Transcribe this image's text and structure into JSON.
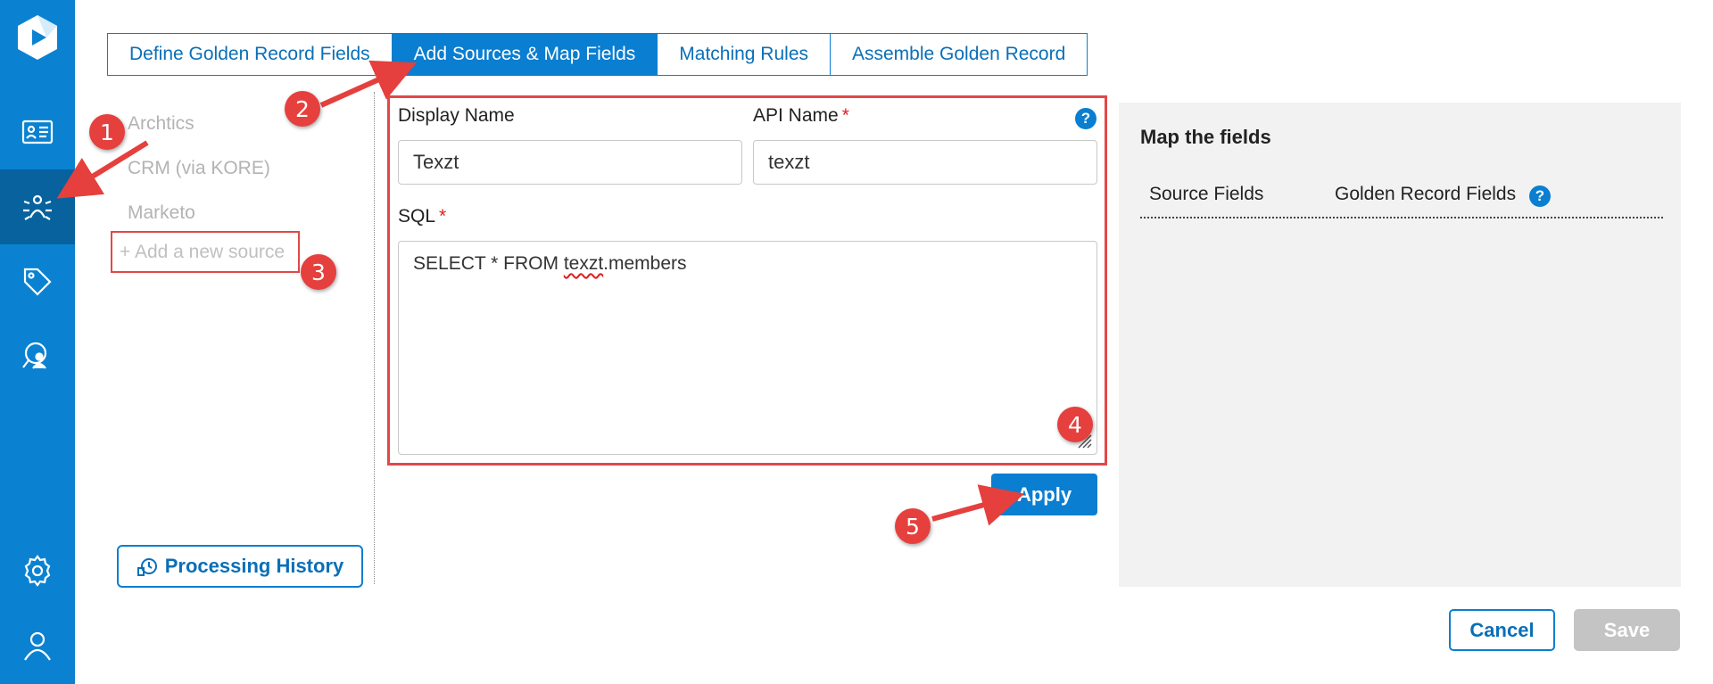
{
  "sidebar": {
    "icons": [
      "logo-icon",
      "contact-card-icon",
      "bug-network-icon",
      "tag-icon",
      "user-search-icon",
      "gear-icon",
      "user-icon"
    ],
    "accent": "#0a82d1",
    "active_bg": "#07629e"
  },
  "tabs": [
    {
      "label": "Define Golden Record Fields",
      "active": false
    },
    {
      "label": "Add Sources & Map Fields",
      "active": true
    },
    {
      "label": "Matching Rules",
      "active": false
    },
    {
      "label": "Assemble Golden Record",
      "active": false
    }
  ],
  "sources": {
    "items": [
      "Archtics",
      "CRM (via KORE)",
      "Marketo"
    ],
    "add_label": "+ Add a new source"
  },
  "processing_history_label": "Processing History",
  "form": {
    "display_name_label": "Display Name",
    "api_name_label": "API Name",
    "required_mark": "*",
    "display_name_value": "Texzt",
    "api_name_value": "texzt",
    "sql_label": "SQL",
    "sql_prefix": "SELECT * FROM ",
    "sql_misspelled": "texzt",
    "sql_suffix": ".members",
    "help": "?",
    "apply_label": "Apply"
  },
  "map_panel": {
    "title": "Map the fields",
    "source_fields_label": "Source Fields",
    "golden_fields_label": "Golden Record Fields",
    "help": "?"
  },
  "footer": {
    "cancel_label": "Cancel",
    "save_label": "Save"
  },
  "callouts": [
    "1",
    "2",
    "3",
    "4",
    "5"
  ],
  "colors": {
    "primary": "#0a7ed0",
    "annotation_red": "#e5403d",
    "disabled": "#c4c4c4"
  }
}
